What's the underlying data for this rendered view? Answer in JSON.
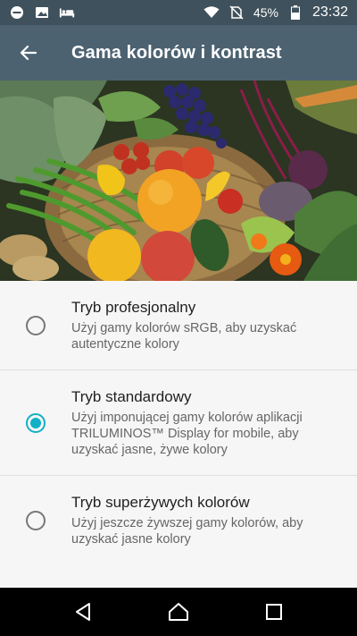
{
  "status_bar": {
    "battery_percent": "45%",
    "time": "23:32",
    "left_icons": [
      "do-not-disturb-icon",
      "image-icon",
      "bed-icon"
    ],
    "right_icons": [
      "wifi-icon",
      "no-sim-icon",
      "battery-icon"
    ]
  },
  "app_bar": {
    "title": "Gama kolorów i kontrast",
    "back_icon": "back-arrow-icon"
  },
  "options": [
    {
      "title": "Tryb profesjonalny",
      "description": "Użyj gamy kolorów sRGB, aby uzyskać autentyczne kolory",
      "selected": false
    },
    {
      "title": "Tryb standardowy",
      "description": "Użyj imponującej gamy kolorów aplikacji TRILUMINOS™ Display for mobile, aby uzyskać jasne, żywe kolory",
      "selected": true
    },
    {
      "title": "Tryb superżywych kolorów",
      "description": "Użyj jeszcze żywszej gamy kolorów, aby uzyskać jasne kolory",
      "selected": false
    }
  ],
  "nav_bar": {
    "buttons": [
      "back-triangle-icon",
      "home-icon",
      "recents-icon"
    ]
  },
  "colors": {
    "status_bar": "#3f515c",
    "app_bar": "#4c6271",
    "accent": "#10b1c5",
    "background": "#f6f6f6"
  }
}
